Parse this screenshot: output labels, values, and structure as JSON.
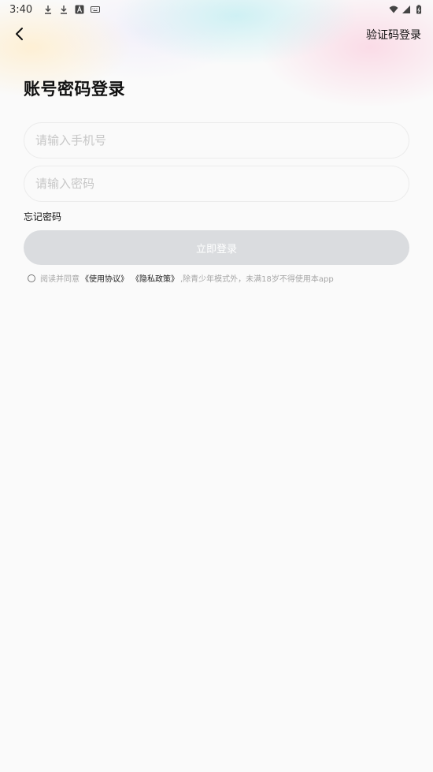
{
  "status_bar": {
    "time": "3:40",
    "left_icons": [
      "download-icon",
      "download-icon",
      "font-icon",
      "keyboard-icon"
    ],
    "right_icons": [
      "wifi-icon",
      "signal-icon",
      "battery-icon"
    ]
  },
  "nav": {
    "back_icon": "chevron-left-icon",
    "right_link": "验证码登录"
  },
  "title": "账号密码登录",
  "form": {
    "phone_placeholder": "请输入手机号",
    "password_placeholder": "请输入密码",
    "forgot_label": "忘记密码",
    "submit_label": "立即登录"
  },
  "agreement": {
    "prefix": "阅读并同意",
    "user_agreement": "《使用协议》",
    "privacy_policy": "《隐私政策》",
    "suffix": ",除青少年模式外，未满18岁不得使用本app"
  },
  "colors": {
    "background": "#fafafa",
    "button_disabled": "#dadcdf",
    "placeholder": "#c7c7c7",
    "muted_text": "#a6a6a6"
  }
}
